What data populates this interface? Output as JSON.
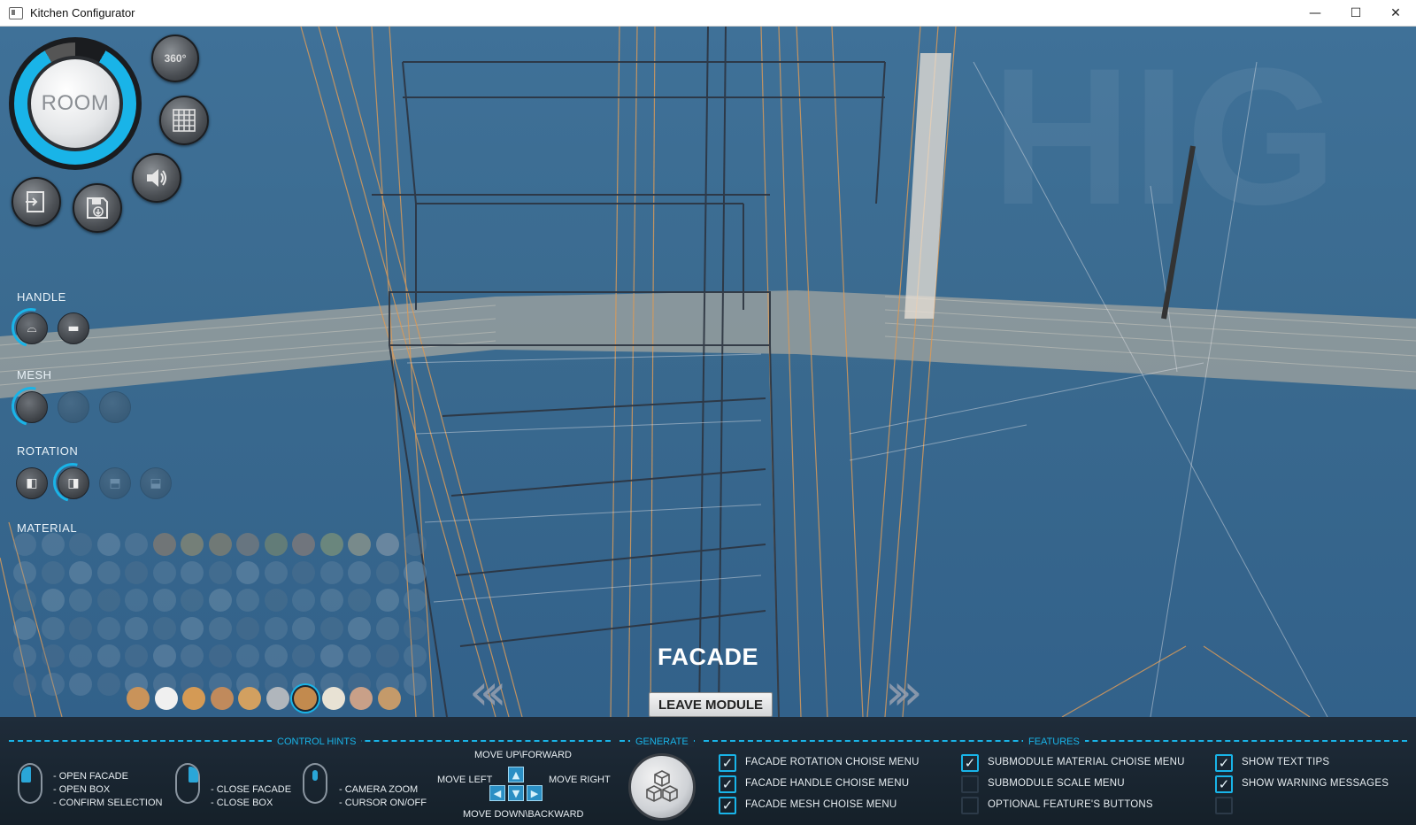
{
  "window": {
    "title": "Kitchen Configurator",
    "minimize": "—",
    "maximize": "☐",
    "close": "✕"
  },
  "toolbar": {
    "room_label": "ROOM",
    "rotate_360_label": "360°"
  },
  "sections": {
    "handle": "HANDLE",
    "mesh": "MESH",
    "rotation": "ROTATION",
    "material": "MATERIAL"
  },
  "center": {
    "facade_title": "FACADE",
    "leave_module": "LEAVE MODULE"
  },
  "control_hints": {
    "title": "CONTROL HINTS",
    "left_click": "- OPEN FACADE\n- OPEN BOX\n- CONFIRM SELECTION",
    "right_click": "- CLOSE FACADE\n- CLOSE BOX",
    "middle": "- CAMERA ZOOM\n- CURSOR ON/OFF",
    "move_up": "MOVE UP\\FORWARD",
    "move_left": "MOVE LEFT",
    "move_right": "MOVE RIGHT",
    "move_down": "MOVE DOWN\\BACKWARD"
  },
  "generate": {
    "title": "GENERATE"
  },
  "features": {
    "title": "FEATURES",
    "items": [
      {
        "label": "FACADE ROTATION CHOISE MENU",
        "checked": true
      },
      {
        "label": "FACADE HANDLE CHOISE MENU",
        "checked": true
      },
      {
        "label": "FACADE MESH CHOISE MENU",
        "checked": true
      },
      {
        "label": "SUBMODULE MATERIAL CHOISE MENU",
        "checked": true
      },
      {
        "label": "SUBMODULE SCALE MENU",
        "checked": false
      },
      {
        "label": "OPTIONAL FEATURE'S BUTTONS",
        "checked": false
      },
      {
        "label": "SHOW TEXT TIPS",
        "checked": true
      },
      {
        "label": "SHOW WARNING MESSAGES",
        "checked": true
      },
      {
        "label": "",
        "checked": false
      }
    ]
  },
  "colors": {
    "accent": "#19b4e8",
    "scene": "#3a6a8f",
    "bar": "#1a2530"
  },
  "material_swatches": {
    "wood_row": [
      "#c9935a",
      "#f0f0f0",
      "#d49a55",
      "#c08a5c",
      "#d2a060",
      "#b0b6bc",
      "#c28a4e",
      "#e8e2d4",
      "#c9a088",
      "#c49a6a"
    ]
  }
}
